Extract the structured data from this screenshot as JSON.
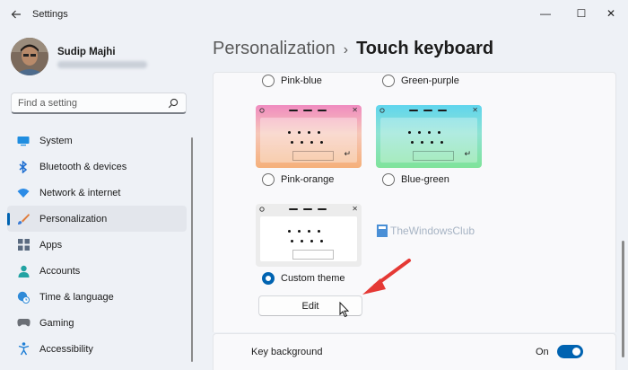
{
  "window": {
    "title": "Settings",
    "back_icon": "arrow-left-icon",
    "minimize_glyph": "—",
    "maximize_glyph": "☐",
    "close_glyph": "✕"
  },
  "user": {
    "name": "Sudip Majhi"
  },
  "search": {
    "placeholder": "Find a setting"
  },
  "sidebar": {
    "items": [
      {
        "label": "System",
        "icon": "monitor-icon",
        "active": false
      },
      {
        "label": "Bluetooth & devices",
        "icon": "bluetooth-icon",
        "active": false
      },
      {
        "label": "Network & internet",
        "icon": "wifi-icon",
        "active": false
      },
      {
        "label": "Personalization",
        "icon": "brush-icon",
        "active": true
      },
      {
        "label": "Apps",
        "icon": "apps-icon",
        "active": false
      },
      {
        "label": "Accounts",
        "icon": "person-icon",
        "active": false
      },
      {
        "label": "Time & language",
        "icon": "globe-clock-icon",
        "active": false
      },
      {
        "label": "Gaming",
        "icon": "gamepad-icon",
        "active": false
      },
      {
        "label": "Accessibility",
        "icon": "accessibility-icon",
        "active": false
      }
    ]
  },
  "breadcrumb": {
    "parent": "Personalization",
    "separator": "›",
    "current": "Touch keyboard"
  },
  "themes": [
    {
      "label": "Pink-blue",
      "selected": false
    },
    {
      "label": "Green-purple",
      "selected": false
    },
    {
      "label": "Pink-orange",
      "selected": false
    },
    {
      "label": "Blue-green",
      "selected": false
    },
    {
      "label": "Custom theme",
      "selected": true
    }
  ],
  "edit_label": "Edit",
  "watermark": "TheWindowsClub",
  "setting": {
    "label": "Key background",
    "state": "On",
    "enabled": true
  },
  "colors": {
    "accent": "#0063b1",
    "annotation_arrow": "#e53935"
  }
}
